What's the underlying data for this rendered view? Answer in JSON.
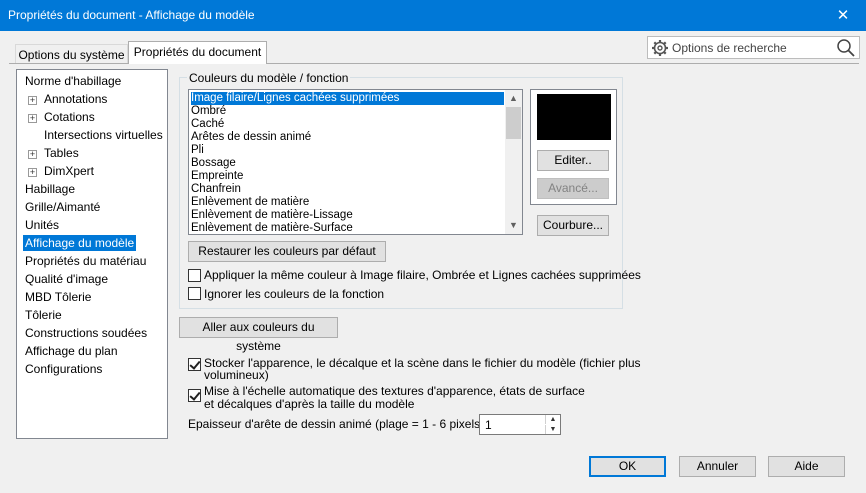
{
  "window": {
    "title": "Propriétés du document - Affichage du modèle",
    "close_glyph": "✕"
  },
  "tabs": [
    {
      "label": "Options du système",
      "active": false
    },
    {
      "label": "Propriétés du document",
      "active": true
    }
  ],
  "search": {
    "placeholder": "Options de recherche"
  },
  "tree": {
    "items": [
      {
        "label": "Norme d'habillage",
        "level": 0,
        "expandable": false,
        "selected": false
      },
      {
        "label": "Annotations",
        "level": 1,
        "expandable": true,
        "selected": false
      },
      {
        "label": "Cotations",
        "level": 1,
        "expandable": true,
        "selected": false
      },
      {
        "label": "Intersections virtuelles",
        "level": 1,
        "expandable": false,
        "selected": false
      },
      {
        "label": "Tables",
        "level": 1,
        "expandable": true,
        "selected": false
      },
      {
        "label": "DimXpert",
        "level": 1,
        "expandable": true,
        "selected": false
      },
      {
        "label": "Habillage",
        "level": 0,
        "expandable": false,
        "selected": false
      },
      {
        "label": "Grille/Aimanté",
        "level": 0,
        "expandable": false,
        "selected": false
      },
      {
        "label": "Unités",
        "level": 0,
        "expandable": false,
        "selected": false
      },
      {
        "label": "Affichage du modèle",
        "level": 0,
        "expandable": false,
        "selected": true
      },
      {
        "label": "Propriétés du matériau",
        "level": 0,
        "expandable": false,
        "selected": false
      },
      {
        "label": "Qualité d'image",
        "level": 0,
        "expandable": false,
        "selected": false
      },
      {
        "label": "MBD Tôlerie",
        "level": 0,
        "expandable": false,
        "selected": false
      },
      {
        "label": "Tôlerie",
        "level": 0,
        "expandable": false,
        "selected": false
      },
      {
        "label": "Constructions soudées",
        "level": 0,
        "expandable": false,
        "selected": false
      },
      {
        "label": "Affichage du plan",
        "level": 0,
        "expandable": false,
        "selected": false
      },
      {
        "label": "Configurations",
        "level": 0,
        "expandable": false,
        "selected": false
      }
    ]
  },
  "colors_group": {
    "title": "Couleurs du modèle / fonction",
    "list": [
      "Image filaire/Lignes cachées supprimées",
      "Ombré",
      "Caché",
      "Arêtes de dessin animé",
      "Pli",
      "Bossage",
      "Empreinte",
      "Chanfrein",
      "Enlèvement de matière",
      "Enlèvement de matière-Lissage",
      "Enlèvement de matière-Surface"
    ],
    "selected_index": 0,
    "swatch_color": "#000000",
    "edit_button": "Editer..",
    "advanced_button": "Avancé...",
    "curvature_button": "Courbure...",
    "restore_button": "Restaurer les couleurs par défaut",
    "apply_same_label": "Appliquer la même couleur à Image filaire, Ombrée et Lignes cachées supprimées",
    "apply_same_checked": false,
    "ignore_label": "Ignorer les couleurs de la fonction",
    "ignore_checked": false
  },
  "system_colors_button": "Aller aux couleurs du système",
  "store_appearance": {
    "line1": "Stocker l'apparence, le décalque et la scène dans le fichier du modèle (fichier plus",
    "line2": "volumineux)",
    "checked": true
  },
  "auto_scale": {
    "line1": "Mise à l'échelle automatique des textures d'apparence, états de surface",
    "line2": "et décalques d'après la taille du modèle",
    "checked": true
  },
  "edge_thickness": {
    "label": "Epaisseur d'arête de dessin animé (plage = 1 - 6 pixels):",
    "value": "1"
  },
  "footer": {
    "ok": "OK",
    "cancel": "Annuler",
    "help": "Aide"
  },
  "colors": {
    "titlebar": "#0078d7",
    "selection": "#0078d7"
  }
}
